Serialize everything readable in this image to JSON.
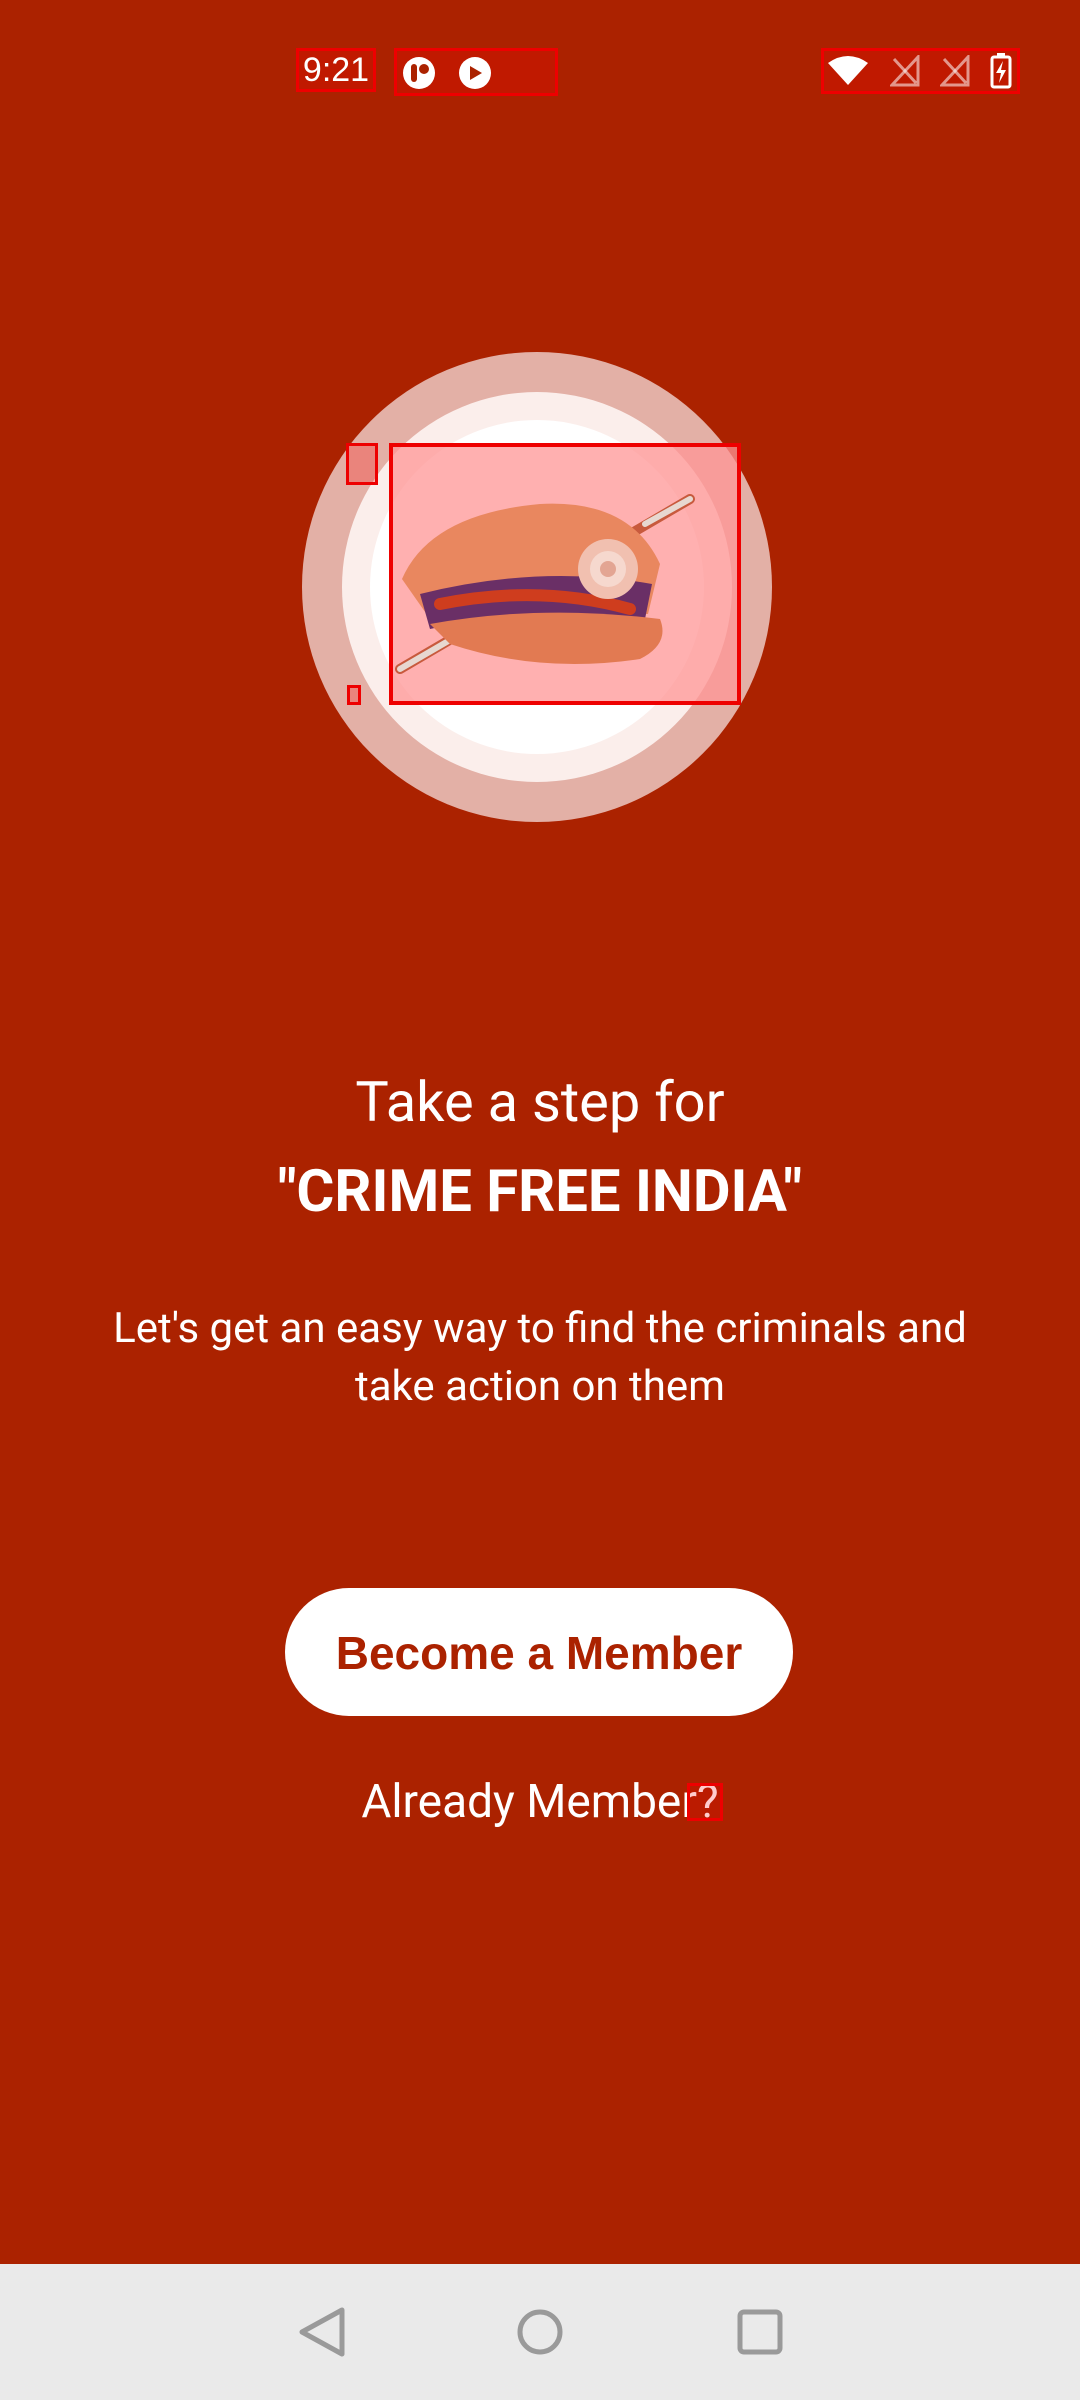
{
  "status_bar": {
    "time": "9:21",
    "left_icons": [
      "app-notification-icon",
      "sync-icon"
    ],
    "right_icons": [
      "wifi-icon",
      "signal-icon",
      "signal-icon",
      "battery-charging-icon"
    ]
  },
  "hero": {
    "illustration": "police-cap-icon"
  },
  "content": {
    "headline_line1": "Take a step for",
    "headline_line2": "\"CRIME FREE INDIA\"",
    "description": "Let's get an easy way to find the criminals and take action on them"
  },
  "actions": {
    "become_member_label": "Become a Member",
    "already_member_label": "Already Member?"
  },
  "nav_bar": {
    "buttons": [
      "back-icon",
      "home-icon",
      "recent-apps-icon"
    ]
  },
  "colors": {
    "background": "#ab2200",
    "button_bg": "#ffffff",
    "button_text": "#ab2200",
    "nav_bar": "#eaeaea"
  }
}
